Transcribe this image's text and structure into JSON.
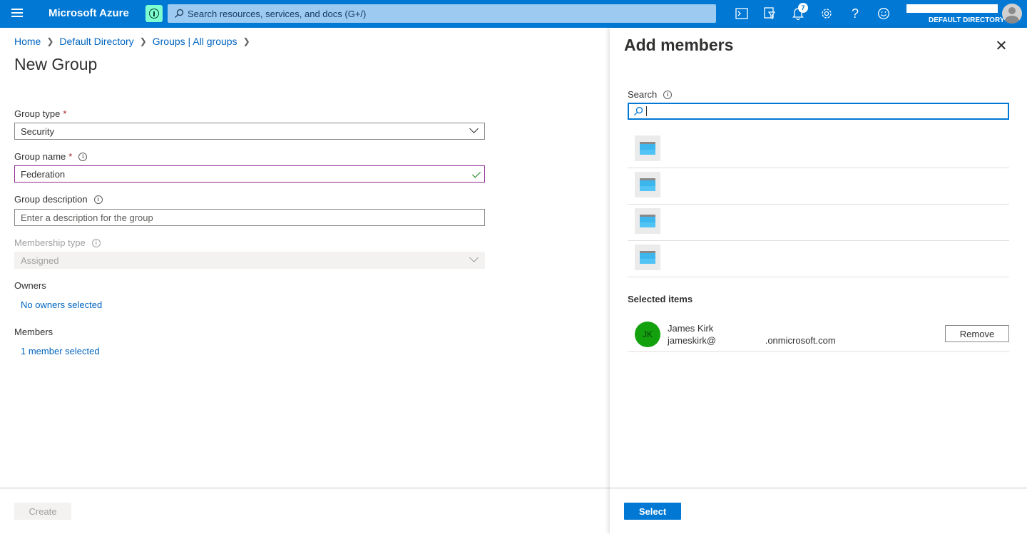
{
  "topbar": {
    "brand": "Microsoft Azure",
    "search_placeholder": "Search resources, services, and docs (G+/)",
    "notifications_count": "7",
    "directory": "DEFAULT DIRECTORY",
    "icons": [
      "menu-icon",
      "upgrade-icon",
      "cloud-shell-icon",
      "directory-filter-icon",
      "notifications-icon",
      "settings-icon",
      "help-icon",
      "feedback-icon",
      "avatar"
    ]
  },
  "breadcrumb": [
    "Home",
    "Default Directory",
    "Groups | All groups"
  ],
  "page_title": "New Group",
  "form": {
    "group_type_label": "Group type",
    "group_type_value": "Security",
    "group_name_label": "Group name",
    "group_name_value": "Federation",
    "group_description_label": "Group description",
    "group_description_placeholder": "Enter a description for the group",
    "membership_type_label": "Membership type",
    "membership_type_value": "Assigned",
    "owners_label": "Owners",
    "owners_link": "No owners selected",
    "members_label": "Members",
    "members_link": "1 member selected",
    "required_mark": "*",
    "create_button": "Create"
  },
  "panel": {
    "title": "Add members",
    "search_label": "Search",
    "results_count": 4,
    "selected_items_title": "Selected items",
    "selected": {
      "initials": "JK",
      "name": "James Kirk",
      "email": "jameskirk@                   .onmicrosoft.com",
      "remove_button": "Remove"
    },
    "select_button": "Select"
  },
  "colors": {
    "azure_blue": "#0078d4",
    "search_bg": "#9ccaf1",
    "avatar_green": "#13a10e",
    "valid_border": "#8f2d8f",
    "required": "#a4262c"
  }
}
